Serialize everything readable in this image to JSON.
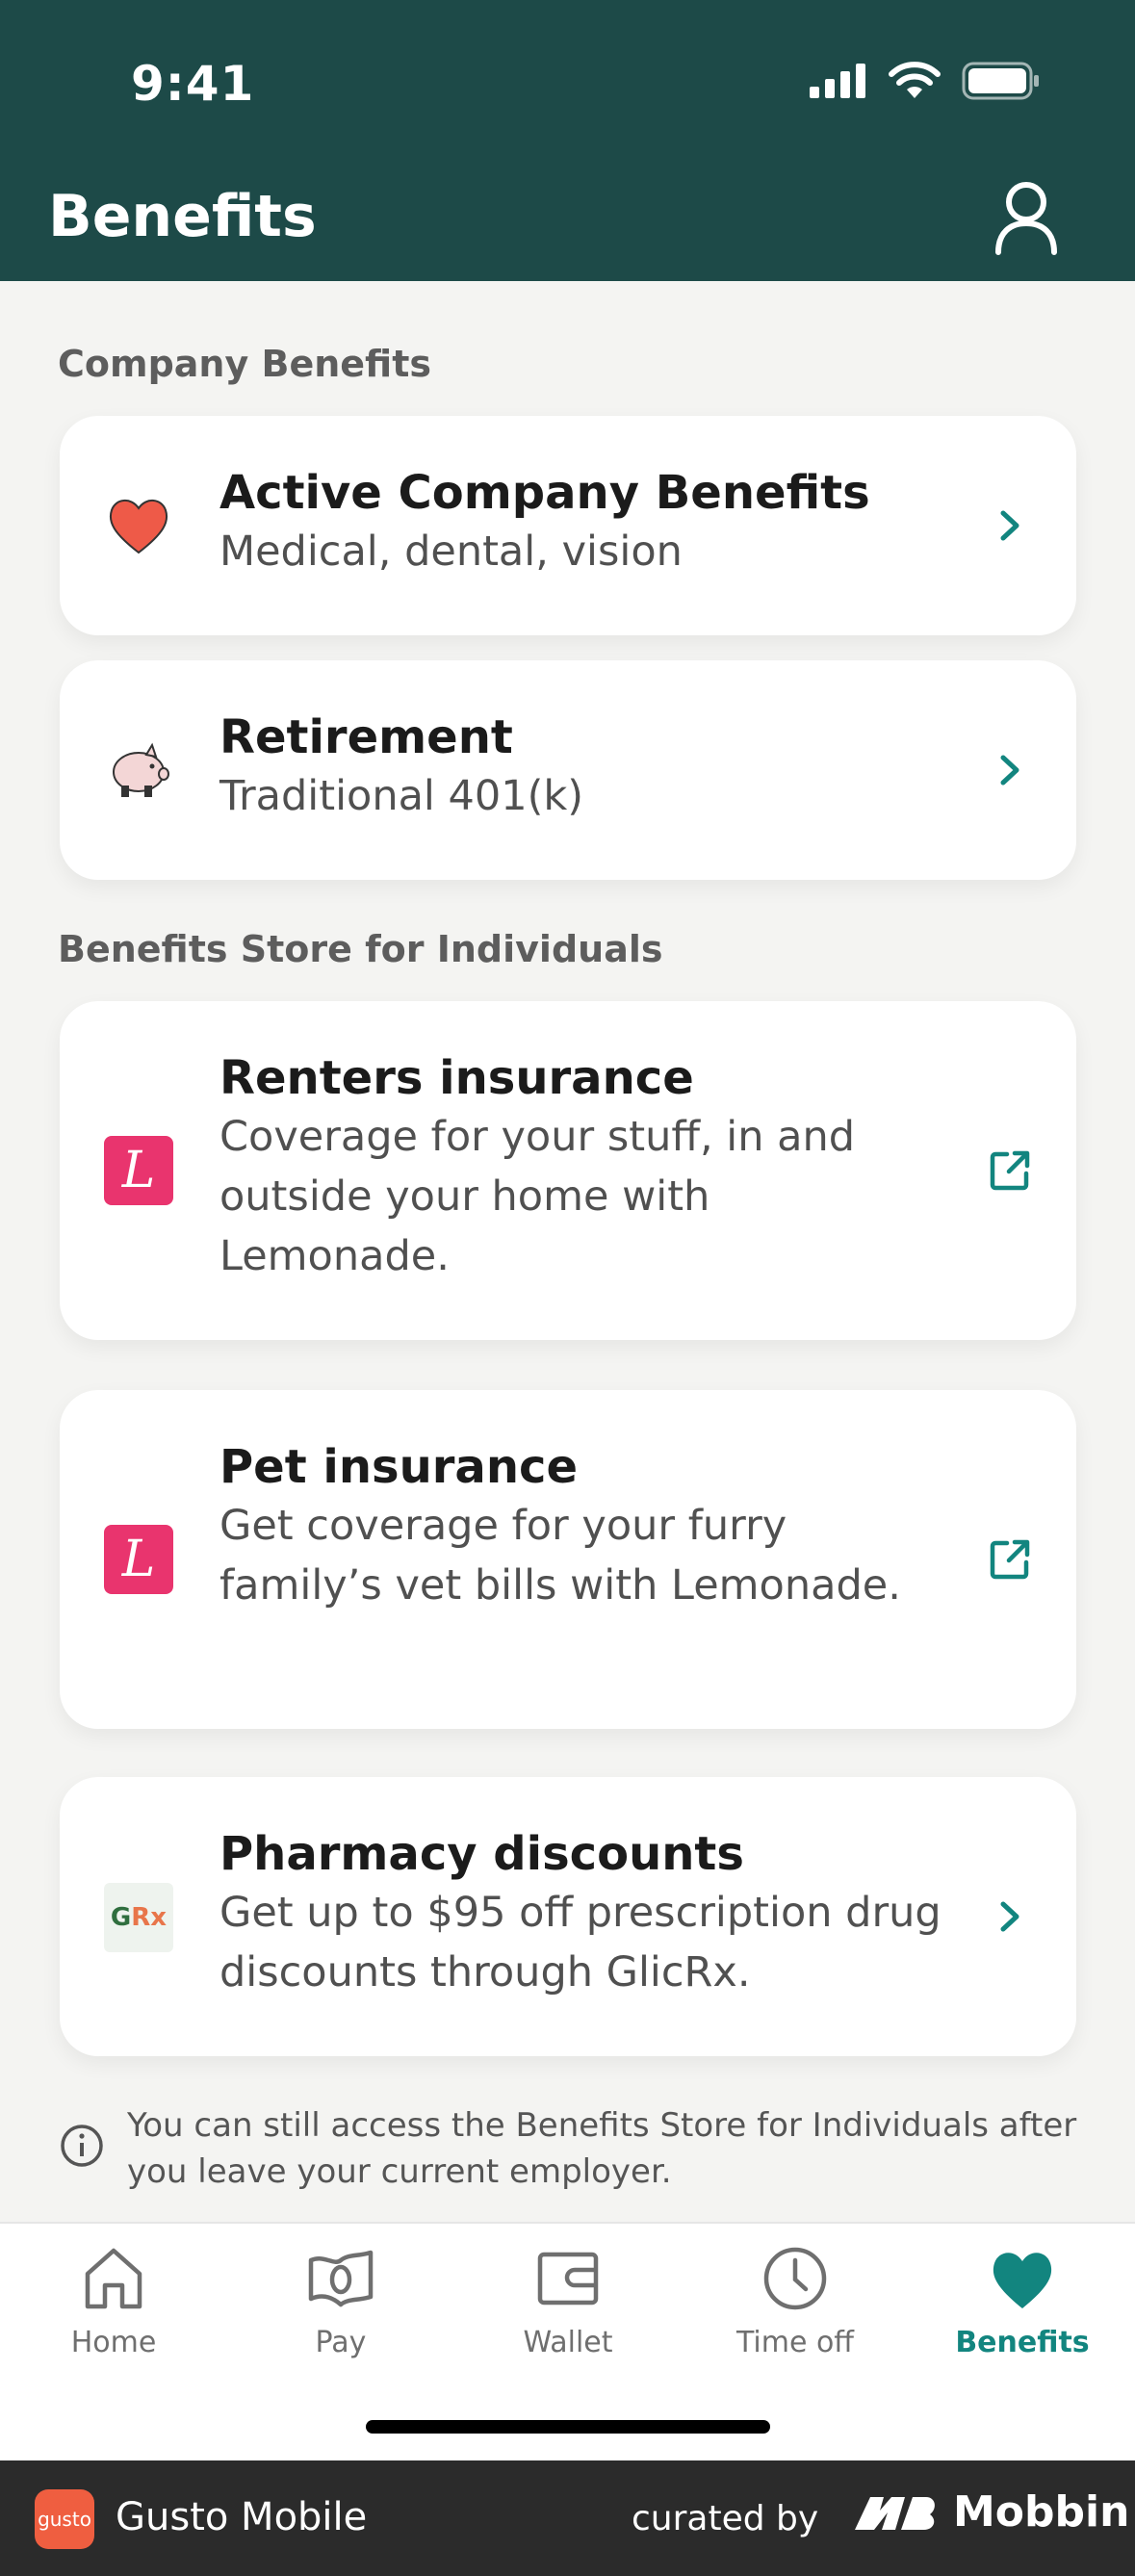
{
  "status_bar": {
    "time": "9:41"
  },
  "header": {
    "title": "Benefits"
  },
  "sections": {
    "company": "Company Benefits",
    "store": "Benefits Store for Individuals"
  },
  "cards": [
    {
      "title": "Active Company Benefits",
      "subtitle": "Medical, dental, vision",
      "icon": "heart-icon",
      "action": "chevron-right-icon"
    },
    {
      "title": "Retirement",
      "subtitle": "Traditional 401(k)",
      "icon": "piggy-bank-icon",
      "action": "chevron-right-icon"
    },
    {
      "title": "Renters insurance",
      "subtitle": "Coverage for your stuff, in and outside your home with Lemonade.",
      "icon": "lemonade-logo",
      "action": "external-link-icon"
    },
    {
      "title": "Pet insurance",
      "subtitle": "Get coverage for your furry family’s vet bills with Lemonade.",
      "icon": "lemonade-logo",
      "action": "external-link-icon"
    },
    {
      "title": "Pharmacy discounts",
      "subtitle": "Get up to $95 off prescription drug discounts through GlicRx.",
      "icon": "glicrx-logo",
      "action": "chevron-right-icon"
    }
  ],
  "logos": {
    "lemonade_glyph": "L",
    "glicrx_g": "G",
    "glicrx_rx": "Rx"
  },
  "info": {
    "text": "You can still access the Benefits Store for Individuals after you leave your current employer."
  },
  "tabs": [
    {
      "label": "Home",
      "icon": "home-icon",
      "active": false
    },
    {
      "label": "Pay",
      "icon": "pay-icon",
      "active": false
    },
    {
      "label": "Wallet",
      "icon": "wallet-icon",
      "active": false
    },
    {
      "label": "Time off",
      "icon": "clock-icon",
      "active": false
    },
    {
      "label": "Benefits",
      "icon": "heart-icon",
      "active": true
    }
  ],
  "footer": {
    "logo_text": "gusto",
    "app_name": "Gusto Mobile",
    "curated_by": "curated by",
    "brand": "Mobbin"
  },
  "colors": {
    "header_bg": "#1d4a48",
    "accent": "#12857f",
    "lemonade": "#e9346e"
  }
}
